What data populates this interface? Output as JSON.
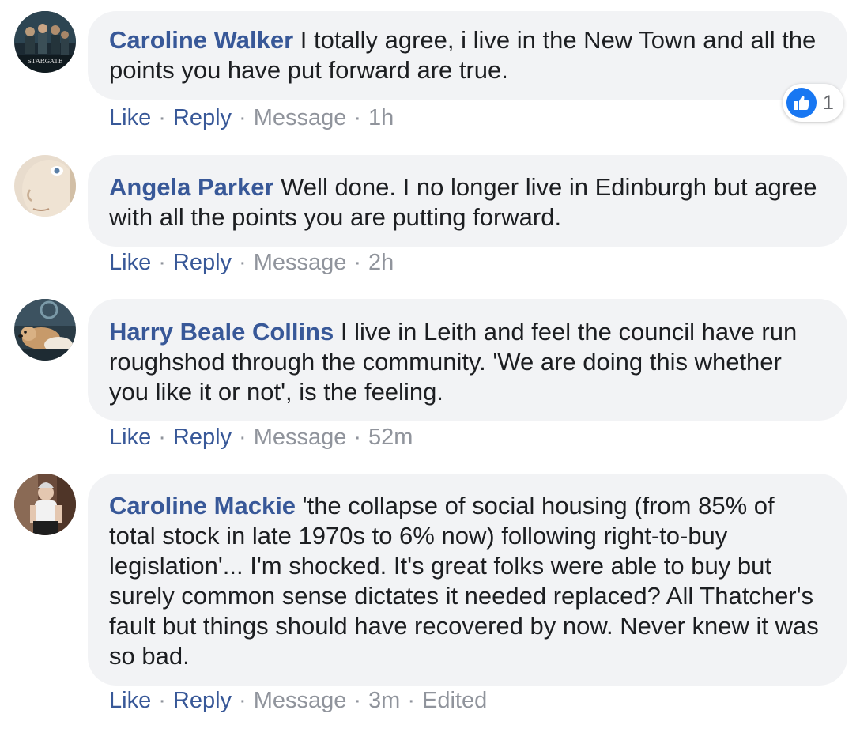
{
  "comments": [
    {
      "author": "Caroline Walker",
      "text": " I totally agree, i live in the New Town and all the points you have put forward are true.",
      "actions": {
        "like": "Like",
        "reply": "Reply",
        "message": "Message",
        "time": "1h"
      },
      "reaction": {
        "icon": "like-icon",
        "count": "1",
        "color": "#1877f2"
      },
      "avatar": {
        "icon": "stargate-poster-avatar",
        "text": "STARGATE"
      }
    },
    {
      "author": "Angela Parker",
      "text": " Well done. I no longer live in Edinburgh but agree with all the points you are putting forward.",
      "actions": {
        "like": "Like",
        "reply": "Reply",
        "message": "Message",
        "time": "2h"
      },
      "avatar": {
        "icon": "doll-face-avatar"
      }
    },
    {
      "author": "Harry Beale Collins",
      "text": " I live in Leith and feel the council have run roughshod through the community. 'We are doing this whether you like it or not', is the feeling.",
      "actions": {
        "like": "Like",
        "reply": "Reply",
        "message": "Message",
        "time": "52m"
      },
      "avatar": {
        "icon": "dog-photo-avatar"
      }
    },
    {
      "author": "Caroline Mackie",
      "text": " 'the collapse of social housing (from 85% of total stock in late 1970s to 6% now) following right-to-buy legislation'... I'm shocked. It's great folks were able to buy but surely common sense dictates it needed replaced? All Thatcher's fault but things should have recovered by now. Never knew it was so bad.",
      "actions": {
        "like": "Like",
        "reply": "Reply",
        "message": "Message",
        "time": "3m",
        "edited": "Edited"
      },
      "avatar": {
        "icon": "person-photo-avatar"
      }
    }
  ],
  "colors": {
    "name": "#385898",
    "bubble": "#f2f3f5",
    "meta": "#90949c",
    "text": "#1c1e21"
  }
}
